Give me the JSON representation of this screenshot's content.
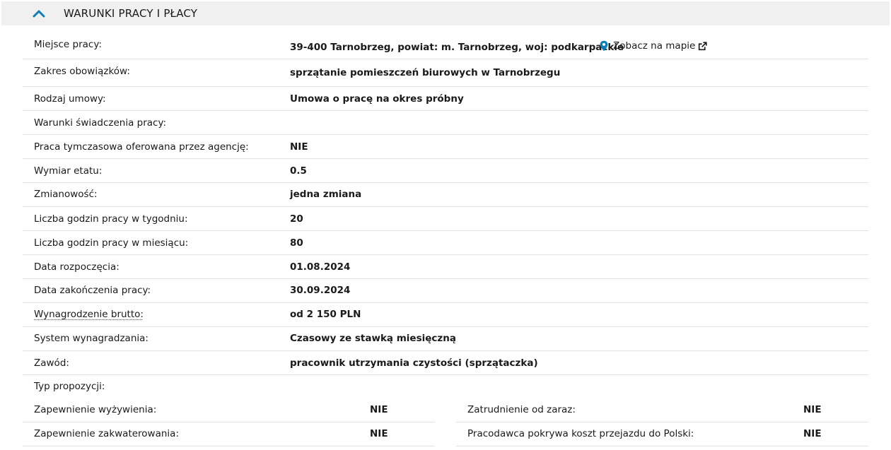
{
  "section": {
    "title": "WARUNKI PRACY I PŁACY",
    "toggle_icon": "chevron-up-icon"
  },
  "colors": {
    "accent": "#0a7fb5",
    "header_bg": "#f0f0f0",
    "divider": "#e3e3e3"
  },
  "location": {
    "label": "Miejsce pracy:",
    "value": "39-400 Tarnobrzeg, powiat: m. Tarnobrzeg, woj: podkarpackie",
    "map_link": "Zobacz na mapie",
    "map_icon": "map-pin-icon",
    "external_icon": "external-link-icon"
  },
  "rows": [
    {
      "label": "Zakres obowiązków:",
      "value": "sprzątanie pomieszczeń biurowych w Tarnobrzegu"
    },
    {
      "label": "Rodzaj umowy:",
      "value": "Umowa o pracę na okres próbny"
    },
    {
      "label": "Warunki świadczenia pracy:",
      "value": ""
    },
    {
      "label": "Praca tymczasowa oferowana przez agencję:",
      "value": "NIE"
    },
    {
      "label": "Wymiar etatu:",
      "value": "0.5"
    },
    {
      "label": "Zmianowość:",
      "value": "jedna zmiana"
    },
    {
      "label": "Liczba godzin pracy w tygodniu:",
      "value": "20"
    },
    {
      "label": "Liczba godzin pracy w miesiącu:",
      "value": "80"
    },
    {
      "label": "Data rozpoczęcia:",
      "value": "01.08.2024"
    },
    {
      "label": "Data zakończenia pracy:",
      "value": "30.09.2024"
    },
    {
      "label": "Wynagrodzenie brutto:",
      "value": "od 2 150 PLN"
    },
    {
      "label": "System wynagradzania:",
      "value": "Czasowy ze stawką miesięczną"
    },
    {
      "label": "Zawód:",
      "value": "pracownik utrzymania czystości (sprzątaczka)"
    }
  ],
  "proposal": {
    "label": "Typ propozycji:",
    "items": [
      {
        "label": "Zapewnienie wyżywienia:",
        "value": "NIE"
      },
      {
        "label": "Zatrudnienie od zaraz:",
        "value": "NIE"
      },
      {
        "label": "Zapewnienie zakwaterowania:",
        "value": "NIE"
      },
      {
        "label": "Pracodawca pokrywa koszt przejazdu do Polski:",
        "value": "NIE"
      }
    ]
  }
}
